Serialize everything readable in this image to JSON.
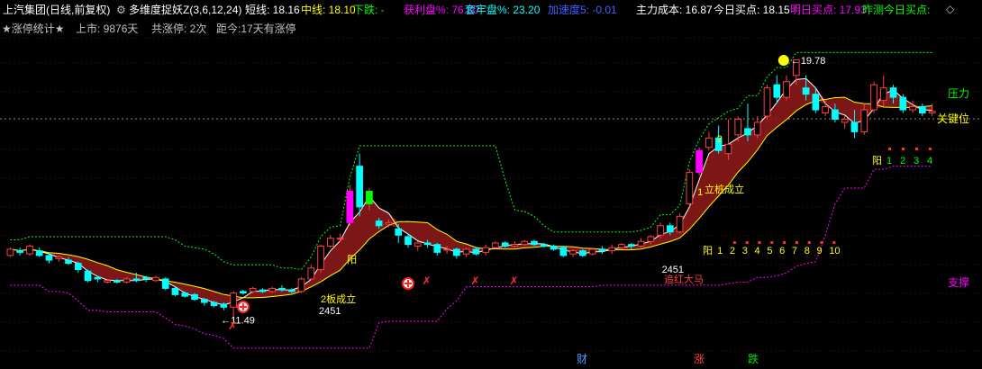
{
  "header": {
    "stock_title": "上汽集团(日线,前复权)",
    "indicator_icon": "gear-icon",
    "indicator_name": "多维度捉妖Z(3,6,12,24)",
    "items": [
      {
        "label": "短线:",
        "value": "18.16",
        "color": "#ffffff"
      },
      {
        "label": "中线:",
        "value": "18.10",
        "color": "#ffff00"
      },
      {
        "label": "下跌:",
        "value": "-",
        "color": "#00ff00"
      },
      {
        "label": "获利盘%:",
        "value": "76.80",
        "color": "#ff00ff"
      },
      {
        "label": "套牢盘%:",
        "value": "23.20",
        "color": "#00ffff"
      },
      {
        "label": "加速度5:",
        "value": "-0.01",
        "color": "#4060ff"
      },
      {
        "label": "主力成本:",
        "value": "16.87",
        "color": "#ffffff"
      },
      {
        "label": "今日买点:",
        "value": "18.15",
        "color": "#ffffff"
      },
      {
        "label": "明日买点:",
        "value": "17.93",
        "color": "#ff00ff"
      },
      {
        "label": "昨测今日买点:",
        "value": "",
        "color": "#00ff00"
      }
    ],
    "diamond_icon": "diamond-outline-icon"
  },
  "subheader": {
    "stats_title": "★涨停统计★",
    "listed": "上市: 9876天",
    "total_limit_up": "共涨停: 2次",
    "since": "距今:17天有涨停"
  },
  "chart_data": {
    "type": "candlestick",
    "ylim": [
      10.5,
      20.5
    ],
    "reference_lines": {
      "resistance": 18.72,
      "support": 14.0
    },
    "max_label": "19.78",
    "min_label": "11.49",
    "candles": [
      [
        13.55,
        13.75,
        13.5,
        13.8
      ],
      [
        13.7,
        13.65,
        13.55,
        13.8
      ],
      [
        13.6,
        13.85,
        13.55,
        13.9
      ],
      [
        13.7,
        13.55,
        13.5,
        13.8
      ],
      [
        13.55,
        13.4,
        13.3,
        13.6
      ],
      [
        13.45,
        13.5,
        13.35,
        13.55
      ],
      [
        13.4,
        13.3,
        13.25,
        13.5
      ],
      [
        13.3,
        13.1,
        13.0,
        13.35
      ],
      [
        13.05,
        12.75,
        12.7,
        13.1
      ],
      [
        12.85,
        12.8,
        12.7,
        12.9
      ],
      [
        12.7,
        12.75,
        12.65,
        12.8
      ],
      [
        12.75,
        12.7,
        12.65,
        12.8
      ],
      [
        12.7,
        12.8,
        12.65,
        12.85
      ],
      [
        12.8,
        12.75,
        12.7,
        13.0
      ],
      [
        12.85,
        12.8,
        12.7,
        12.9
      ],
      [
        12.75,
        12.85,
        12.7,
        12.9
      ],
      [
        12.8,
        12.5,
        12.45,
        12.85
      ],
      [
        12.5,
        12.3,
        12.25,
        12.55
      ],
      [
        12.35,
        12.25,
        12.2,
        12.4
      ],
      [
        12.3,
        12.15,
        12.1,
        12.35
      ],
      [
        12.15,
        12.05,
        11.95,
        12.2
      ],
      [
        12.05,
        11.95,
        11.9,
        12.1
      ],
      [
        12.0,
        11.9,
        11.8,
        12.05
      ],
      [
        11.9,
        12.35,
        11.49,
        12.4
      ],
      [
        12.4,
        12.35,
        12.3,
        12.45
      ],
      [
        12.4,
        12.5,
        12.35,
        12.55
      ],
      [
        12.45,
        12.4,
        12.35,
        12.5
      ],
      [
        12.4,
        12.5,
        12.35,
        12.55
      ],
      [
        12.5,
        12.45,
        12.4,
        12.6
      ],
      [
        12.45,
        12.4,
        12.35,
        12.5
      ],
      [
        12.4,
        12.8,
        12.35,
        12.85
      ],
      [
        12.8,
        13.15,
        12.75,
        13.25
      ],
      [
        13.1,
        13.85,
        13.0,
        13.9
      ],
      [
        13.85,
        14.1,
        13.8,
        14.2
      ],
      [
        14.1,
        14.1,
        14.0,
        14.25
      ],
      [
        14.6,
        15.6,
        14.5,
        15.8
      ],
      [
        16.4,
        15.1,
        14.8,
        16.8
      ],
      [
        15.2,
        15.6,
        15.0,
        15.7
      ],
      [
        14.65,
        14.5,
        14.4,
        14.75
      ],
      [
        14.55,
        14.6,
        14.45,
        14.7
      ],
      [
        14.4,
        14.2,
        13.95,
        14.55
      ],
      [
        14.15,
        13.9,
        13.8,
        14.25
      ],
      [
        13.85,
        13.95,
        13.7,
        14.0
      ],
      [
        13.95,
        13.9,
        13.8,
        14.05
      ],
      [
        13.9,
        13.65,
        13.55,
        13.95
      ],
      [
        13.75,
        13.75,
        13.6,
        13.85
      ],
      [
        13.75,
        13.55,
        13.45,
        13.8
      ],
      [
        13.6,
        13.75,
        13.5,
        13.8
      ],
      [
        13.75,
        13.6,
        13.55,
        13.8
      ],
      [
        13.65,
        13.8,
        13.55,
        13.9
      ],
      [
        13.8,
        13.95,
        13.75,
        14.0
      ],
      [
        13.95,
        13.85,
        13.8,
        14.0
      ],
      [
        13.85,
        13.9,
        13.8,
        14.0
      ],
      [
        13.9,
        14.0,
        13.85,
        14.05
      ],
      [
        14.0,
        13.9,
        13.85,
        14.05
      ],
      [
        13.9,
        13.85,
        13.8,
        13.95
      ],
      [
        13.85,
        13.75,
        13.7,
        13.9
      ],
      [
        13.8,
        13.55,
        13.5,
        13.85
      ],
      [
        13.6,
        13.7,
        13.5,
        13.75
      ],
      [
        13.7,
        13.55,
        13.5,
        13.75
      ],
      [
        13.6,
        13.75,
        13.55,
        13.8
      ],
      [
        13.75,
        13.7,
        13.6,
        13.85
      ],
      [
        13.7,
        13.8,
        13.6,
        13.9
      ],
      [
        13.8,
        13.9,
        13.75,
        13.95
      ],
      [
        13.9,
        13.85,
        13.75,
        13.95
      ],
      [
        13.85,
        14.0,
        13.8,
        14.1
      ],
      [
        14.0,
        14.15,
        13.9,
        14.2
      ],
      [
        14.2,
        14.5,
        14.1,
        14.6
      ],
      [
        14.5,
        14.3,
        14.2,
        14.6
      ],
      [
        14.3,
        14.8,
        14.25,
        14.9
      ],
      [
        15.2,
        16.2,
        15.1,
        16.3
      ],
      [
        16.2,
        16.9,
        16.1,
        17.0
      ],
      [
        17.0,
        17.3,
        16.9,
        17.5
      ],
      [
        17.3,
        16.9,
        16.8,
        17.7
      ],
      [
        16.8,
        17.1,
        16.6,
        17.9
      ],
      [
        17.4,
        17.9,
        17.2,
        18.0
      ],
      [
        17.6,
        17.4,
        17.2,
        18.4
      ],
      [
        17.4,
        17.8,
        17.3,
        18.0
      ],
      [
        18.0,
        18.9,
        17.9,
        19.0
      ],
      [
        19.0,
        18.6,
        18.4,
        19.3
      ],
      [
        18.6,
        19.1,
        18.5,
        19.3
      ],
      [
        19.3,
        19.8,
        19.0,
        19.78
      ],
      [
        18.9,
        18.7,
        18.5,
        19.3
      ],
      [
        18.7,
        18.2,
        18.1,
        18.9
      ],
      [
        18.1,
        18.3,
        18.0,
        18.5
      ],
      [
        18.2,
        17.9,
        17.8,
        18.4
      ],
      [
        17.8,
        17.9,
        17.6,
        18.0
      ],
      [
        17.8,
        17.5,
        17.3,
        18.2
      ],
      [
        17.5,
        18.2,
        17.4,
        18.4
      ],
      [
        18.2,
        19.0,
        18.1,
        19.1
      ],
      [
        18.5,
        18.9,
        18.3,
        19.3
      ],
      [
        18.9,
        18.6,
        18.4,
        19.0
      ],
      [
        18.6,
        18.2,
        18.1,
        18.7
      ],
      [
        18.2,
        18.3,
        18.1,
        18.5
      ],
      [
        18.3,
        18.1,
        18.0,
        18.4
      ],
      [
        18.1,
        18.16,
        18.0,
        18.4
      ]
    ],
    "marker_labels": [
      "2板成立",
      "2451",
      "阳",
      "立桩成立",
      "2451",
      "追红大马",
      "阳",
      "1",
      "2",
      "3",
      "4",
      "5",
      "6",
      "7",
      "8",
      "9",
      "10",
      "1",
      "2",
      "3",
      "4",
      "1",
      "2"
    ],
    "right_labels": {
      "resistance": "压力",
      "key": "关键位",
      "support": "支撑"
    },
    "bottom_labels": [
      {
        "text": "财",
        "color": "#4f9cff"
      },
      {
        "text": "涨",
        "color": "#ff4040"
      },
      {
        "text": "跌",
        "color": "#00e000"
      }
    ],
    "colors": {
      "up": "#ff4040",
      "down": "#00ffff",
      "band": "#8b1a1a",
      "short_line": "#ffffff",
      "mid_line": "#ffff00",
      "resistance": "#00ff00",
      "support": "#ff00ff"
    }
  }
}
